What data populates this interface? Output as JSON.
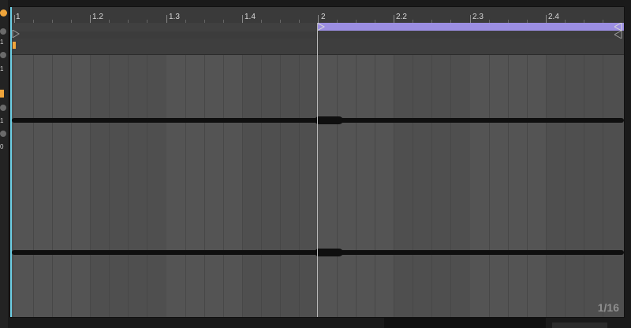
{
  "left_strip": {
    "labels": [
      "1",
      "1",
      "1",
      "0"
    ]
  },
  "ruler": {
    "labels": [
      "1",
      "1.2",
      "1.3",
      "1.4",
      "2",
      "2.2",
      "2.3",
      "2.4"
    ]
  },
  "editor": {
    "grid_label": "1/16"
  },
  "colors": {
    "loop": "#9b8ee2",
    "playhead": "#6ed0e6",
    "waveform": "#0f0f0f"
  }
}
